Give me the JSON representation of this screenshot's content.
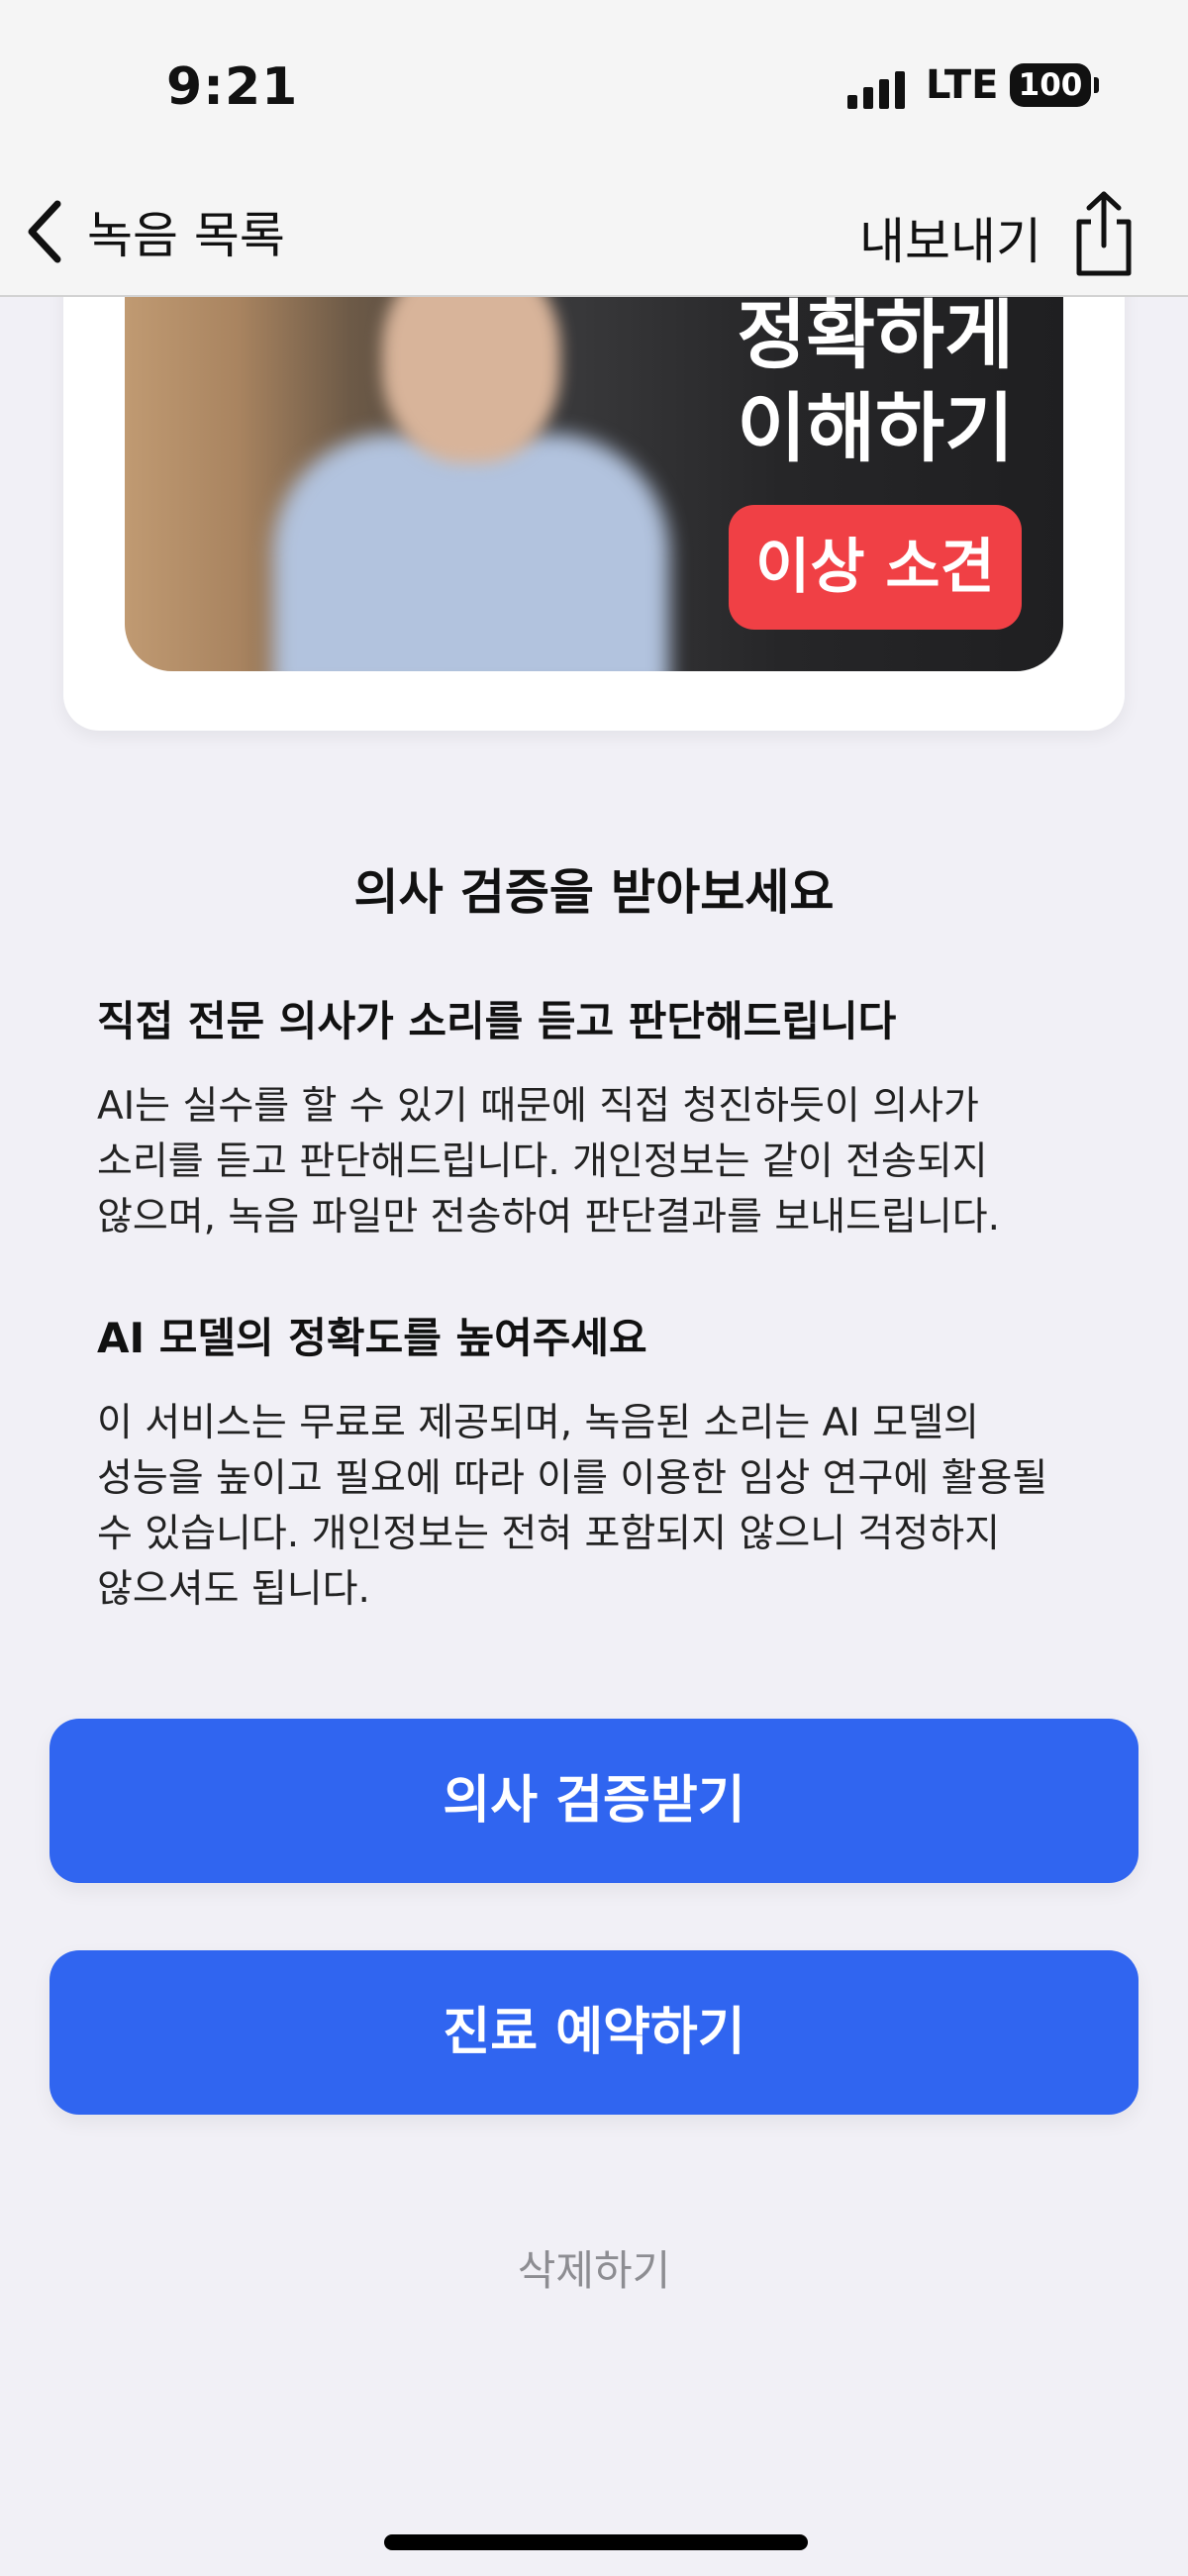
{
  "status_bar": {
    "time": "9:21",
    "network": "LTE",
    "battery": "100"
  },
  "nav": {
    "back_label": "녹음 목록",
    "export_label": "내보내기",
    "back_icon": "chevron-left-icon",
    "share_icon": "share-icon"
  },
  "video": {
    "title_line1": "정확하게",
    "title_line2": "이해하기",
    "badge": "이상 소견"
  },
  "verification": {
    "title": "의사 검증을 받아보세요",
    "sections": [
      {
        "heading": "직접 전문 의사가 소리를 듣고 판단해드립니다",
        "body": "AI는 실수를 할 수 있기 때문에 직접 청진하듯이 의사가\n소리를 듣고 판단해드립니다. 개인정보는 같이 전송되지\n않으며, 녹음 파일만 전송하여 판단결과를 보내드립니다."
      },
      {
        "heading": "AI 모델의 정확도를 높여주세요",
        "body": "이 서비스는 무료로 제공되며, 녹음된 소리는 AI 모델의\n성능을 높이고 필요에 따라 이를 이용한 임상 연구에 활용될\n수 있습니다. 개인정보는 전혀 포함되지 않으니 걱정하지\n않으셔도 됩니다."
      }
    ]
  },
  "actions": {
    "verify_label": "의사 검증받기",
    "reserve_label": "진료 예약하기",
    "delete_label": "삭제하기"
  },
  "colors": {
    "primary": "#3065f0",
    "badge": "#f04045",
    "background": "#f1f0f6"
  }
}
